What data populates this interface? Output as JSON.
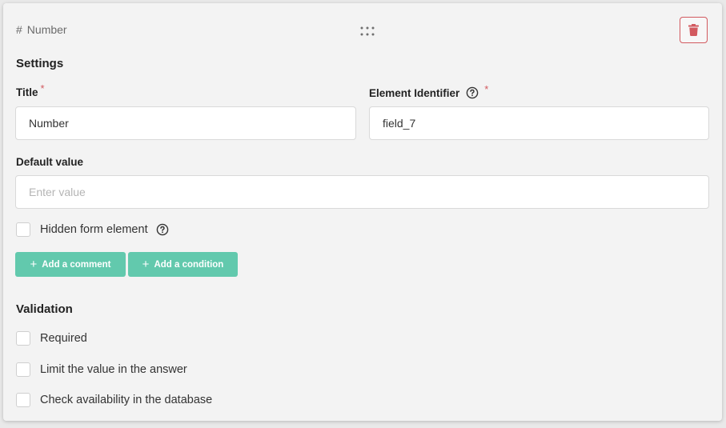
{
  "header": {
    "type_icon": "hash-icon",
    "type_label": "Number",
    "drag_icon": "drag-handle-icon",
    "delete_icon": "trash-icon"
  },
  "settings": {
    "title": "Settings",
    "title_field": {
      "label": "Title",
      "required_mark": "*",
      "value": "Number"
    },
    "identifier_field": {
      "label": "Element Identifier",
      "required_mark": "*",
      "value": "field_7",
      "help_icon": "question-circle-icon"
    },
    "default_value": {
      "label": "Default value",
      "placeholder": "Enter value",
      "value": ""
    },
    "hidden_element": {
      "label": "Hidden form element",
      "checked": false,
      "help_icon": "question-circle-icon"
    },
    "buttons": {
      "add_comment": "Add a comment",
      "add_condition": "Add a condition"
    }
  },
  "validation": {
    "title": "Validation",
    "options": [
      {
        "label": "Required",
        "checked": false
      },
      {
        "label": "Limit the value in the answer",
        "checked": false
      },
      {
        "label": "Check availability in the database",
        "checked": false
      }
    ]
  },
  "colors": {
    "accent_green": "#62c9ad",
    "danger_red": "#d2595f",
    "card_bg": "#f3f3f3"
  }
}
